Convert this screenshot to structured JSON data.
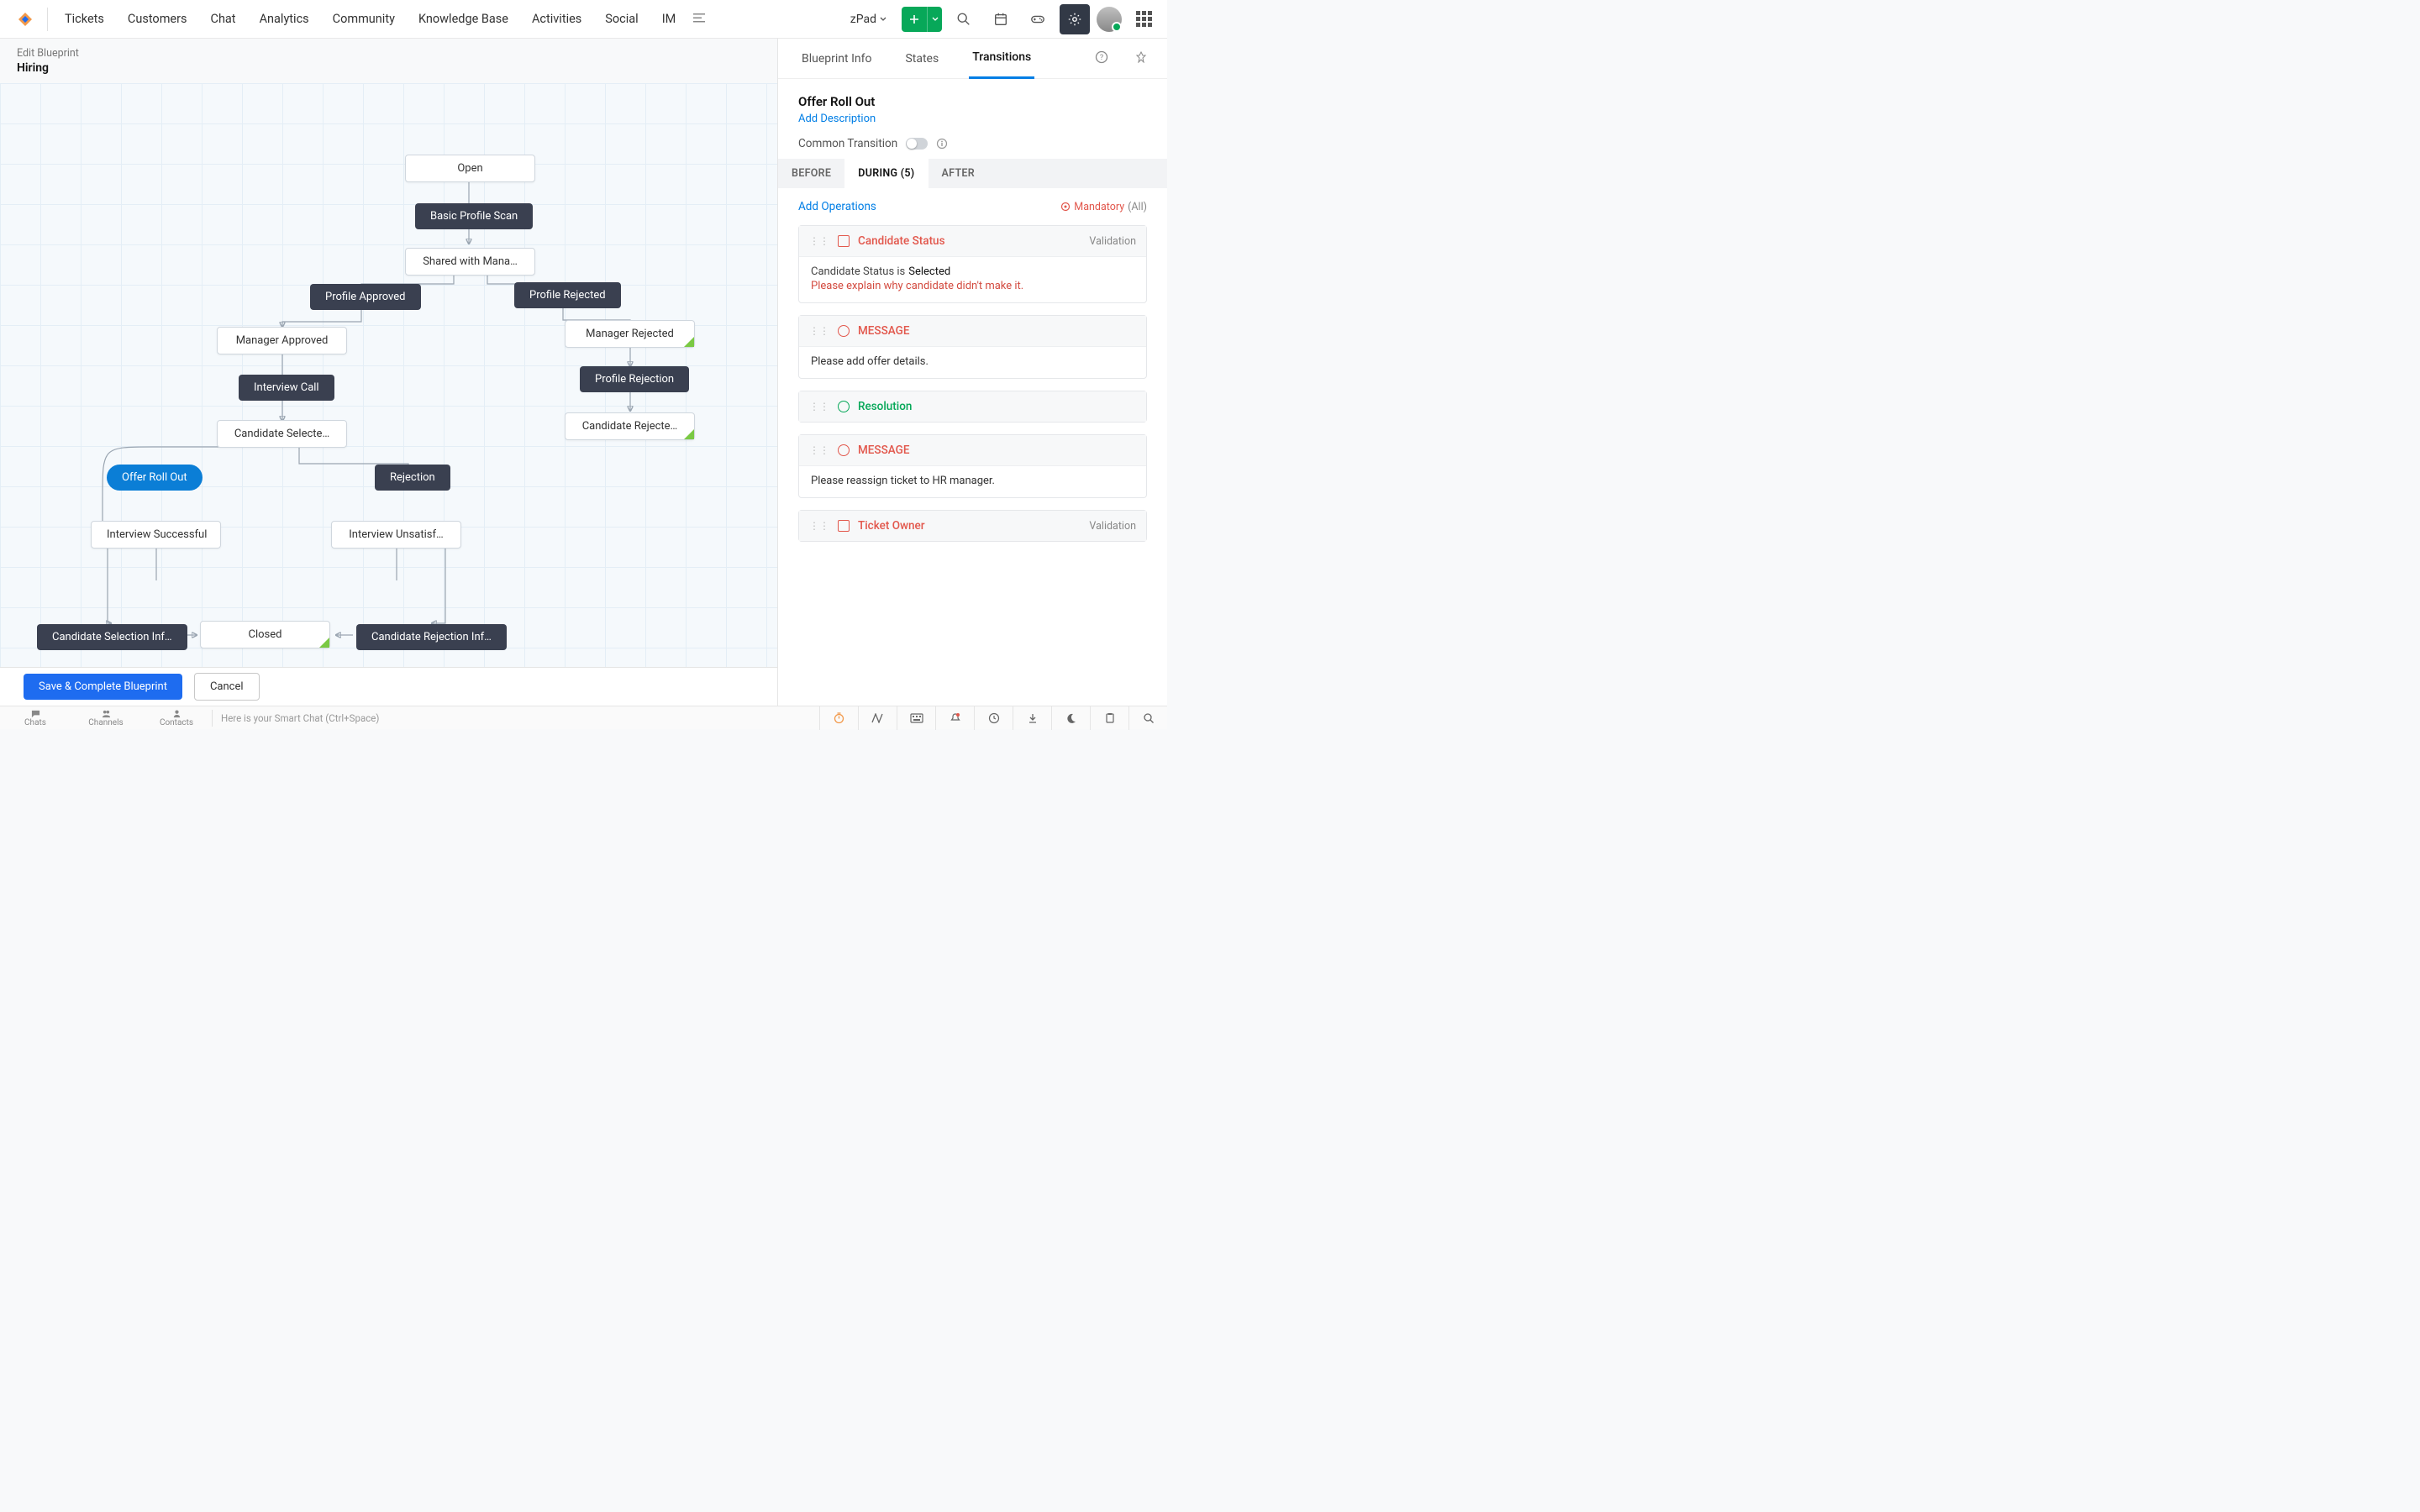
{
  "nav": {
    "items": [
      "Tickets",
      "Customers",
      "Chat",
      "Analytics",
      "Community",
      "Knowledge Base",
      "Activities",
      "Social",
      "IM"
    ],
    "org": "zPad"
  },
  "header": {
    "breadcrumb": "Edit Blueprint",
    "title": "Hiring"
  },
  "nodes": {
    "open": "Open",
    "basic_profile_scan": "Basic Profile Scan",
    "shared_with_manager": "Shared with Mana…",
    "profile_approved": "Profile Approved",
    "profile_rejected": "Profile Rejected",
    "manager_approved": "Manager Approved",
    "manager_rejected": "Manager Rejected",
    "interview_call": "Interview Call",
    "profile_rejection": "Profile Rejection",
    "candidate_selected": "Candidate Selecte…",
    "candidate_rejected": "Candidate Rejecte…",
    "offer_roll_out": "Offer Roll Out",
    "rejection": "Rejection",
    "interview_successful": "Interview Successful",
    "interview_unsatisf": "Interview Unsatisf…",
    "candidate_selection_info": "Candidate Selection Inf…",
    "candidate_rejection_info": "Candidate Rejection Inf…",
    "closed": "Closed"
  },
  "footer": {
    "save": "Save & Complete Blueprint",
    "cancel": "Cancel"
  },
  "panel": {
    "tabs": [
      "Blueprint Info",
      "States",
      "Transitions"
    ],
    "title": "Offer Roll Out",
    "add_description": "Add Description",
    "common_transition": "Common Transition",
    "phase_tabs": [
      "BEFORE",
      "DURING (5)",
      "AFTER"
    ],
    "add_operations": "Add Operations",
    "mandatory": "Mandatory",
    "mandatory_suffix": "(All)",
    "ops": [
      {
        "icon": "field",
        "title": "Candidate Status",
        "validation": "Validation",
        "body_label": "Candidate Status is",
        "body_value": "Selected",
        "error": "Please explain why candidate didn't make it."
      },
      {
        "icon": "msg",
        "title": "MESSAGE",
        "body": "Please add offer details."
      },
      {
        "icon": "res",
        "title": "Resolution",
        "title_class": "green"
      },
      {
        "icon": "msg",
        "title": "MESSAGE",
        "body": "Please reassign ticket to HR manager."
      },
      {
        "icon": "field",
        "title": "Ticket Owner",
        "validation": "Validation"
      }
    ]
  },
  "bottombar": {
    "tabs": [
      "Chats",
      "Channels",
      "Contacts"
    ],
    "hint": "Here is your Smart Chat (Ctrl+Space)"
  }
}
